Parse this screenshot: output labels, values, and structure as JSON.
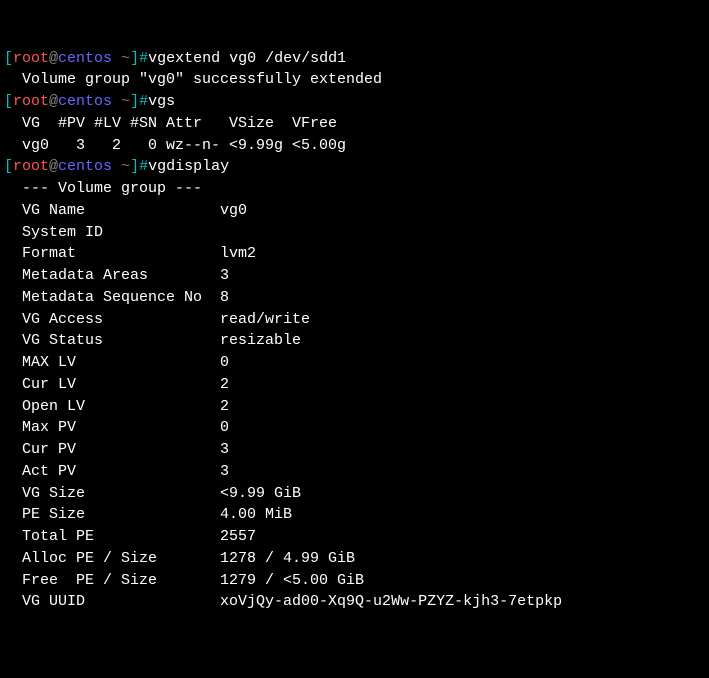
{
  "prompt": {
    "openBracket": "[",
    "user": "root",
    "at": "@",
    "host": "centos",
    "path": " ~",
    "closeBracket": "]",
    "hash": "#"
  },
  "blocks": [
    {
      "command": "vgextend vg0 /dev/sdd1",
      "output": "  Volume group \"vg0\" successfully extended"
    },
    {
      "command": "vgs",
      "output": "  VG  #PV #LV #SN Attr   VSize  VFree\n  vg0   3   2   0 wz--n- <9.99g <5.00g"
    },
    {
      "command": "vgdisplay",
      "output": "  --- Volume group ---\n  VG Name               vg0\n  System ID\n  Format                lvm2\n  Metadata Areas        3\n  Metadata Sequence No  8\n  VG Access             read/write\n  VG Status             resizable\n  MAX LV                0\n  Cur LV                2\n  Open LV               2\n  Max PV                0\n  Cur PV                3\n  Act PV                3\n  VG Size               <9.99 GiB\n  PE Size               4.00 MiB\n  Total PE              2557\n  Alloc PE / Size       1278 / 4.99 GiB\n  Free  PE / Size       1279 / <5.00 GiB\n  VG UUID               xoVjQy-ad00-Xq9Q-u2Ww-PZYZ-kjh3-7etpkp"
    }
  ]
}
